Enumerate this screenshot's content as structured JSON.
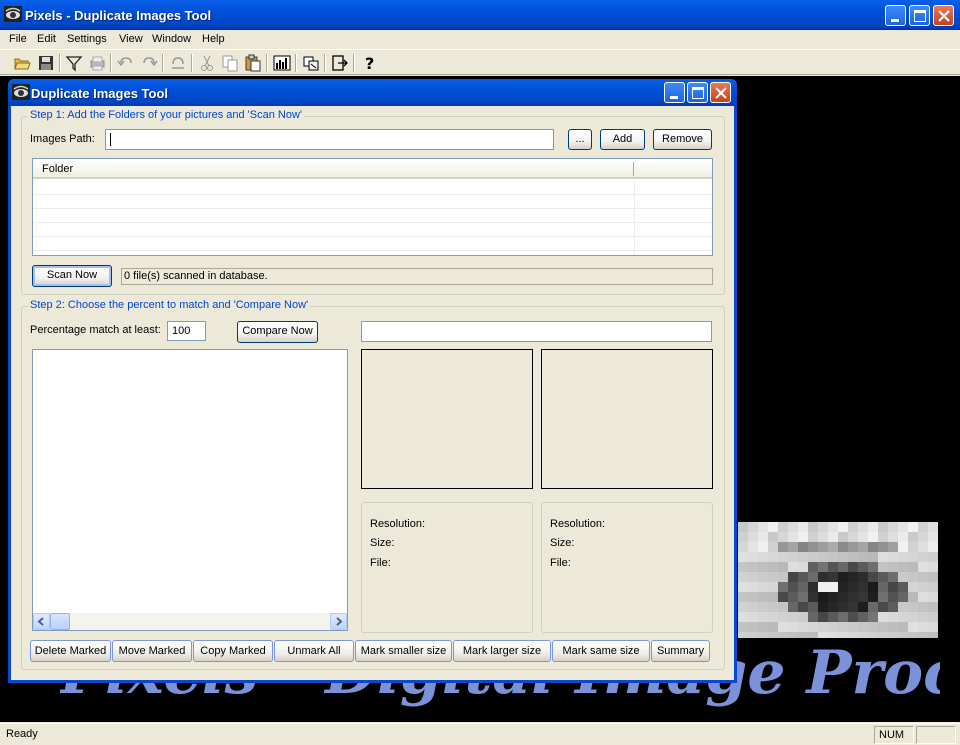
{
  "main_window": {
    "title": "Pixels - Duplicate Images Tool"
  },
  "menu": [
    "File",
    "Edit",
    "Settings",
    "View",
    "Window",
    "Help"
  ],
  "background": {
    "banner": "Pixels - Digital Image Processing"
  },
  "statusbar": {
    "ready": "Ready",
    "num": "NUM"
  },
  "dialog": {
    "title": "Duplicate Images Tool",
    "step1": {
      "label": "Step 1: Add the Folders of your pictures and 'Scan Now'",
      "images_path_label": "Images Path:",
      "images_path_value": "",
      "browse": "...",
      "add": "Add",
      "remove": "Remove",
      "column_folder": "Folder",
      "scan_now": "Scan Now",
      "scan_status": "0 file(s) scanned in database."
    },
    "step2": {
      "label": "Step 2: Choose the percent to match and 'Compare Now'",
      "percentage_label": "Percentage match at least:",
      "percentage_value": "100",
      "compare_now": "Compare Now",
      "compare_field": "",
      "left_info": {
        "resolution": "Resolution:",
        "size": "Size:",
        "file": "File:"
      },
      "right_info": {
        "resolution": "Resolution:",
        "size": "Size:",
        "file": "File:"
      }
    },
    "actions": {
      "delete_marked": "Delete  Marked",
      "move_marked": "Move  Marked",
      "copy_marked": "Copy Marked",
      "unmark_all": "Unmark All",
      "mark_smaller": "Mark smaller size",
      "mark_larger": "Mark larger size",
      "mark_same": "Mark same size",
      "summary": "Summary"
    }
  }
}
